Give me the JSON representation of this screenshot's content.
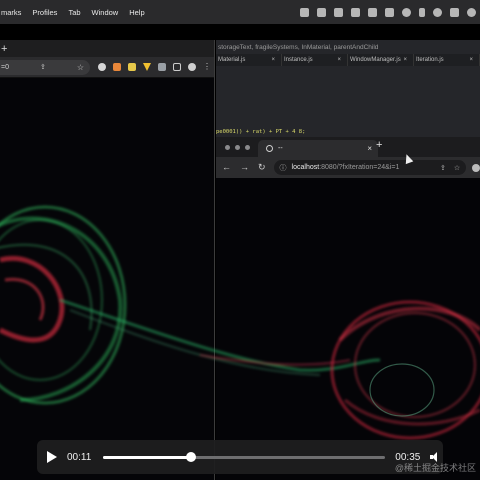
{
  "menubar": {
    "items": [
      "marks",
      "Profiles",
      "Tab",
      "Window",
      "Help"
    ]
  },
  "left_browser": {
    "new_tab": "+",
    "url_fragment": "=0"
  },
  "editor": {
    "breadcrumb": "storageText, fragileSystems, InMaterial, parentAndChild",
    "tabs": [
      "Material.js",
      "Instance.js",
      "WindowManager.js",
      "Iteration.js"
    ],
    "code_line": "pe0001)) + rat) + PT + 4 8;"
  },
  "right_browser": {
    "tab_title": "--",
    "tab_close": "×",
    "new_tab": "+",
    "url_host": "localhost",
    "url_rest": ":8080/?fxIteration=24&i=1"
  },
  "player": {
    "current_time": "00:11",
    "duration": "00:35",
    "progress_fraction": 0.31
  },
  "watermark": "@稀土掘金技术社区"
}
